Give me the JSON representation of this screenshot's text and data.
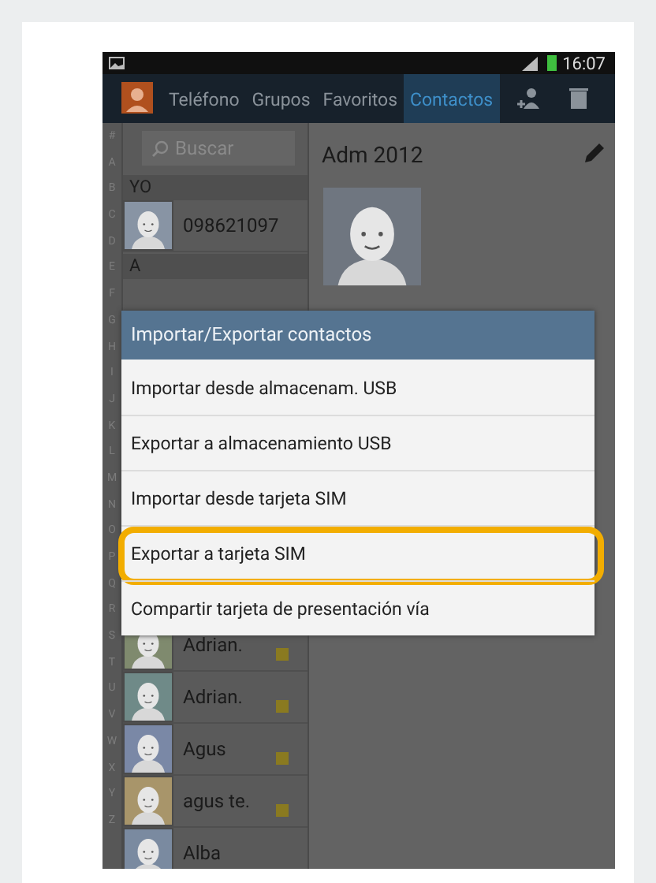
{
  "status_bar": {
    "time": "16:07"
  },
  "action_bar": {
    "tabs": [
      {
        "label": "Teléfono",
        "selected": false
      },
      {
        "label": "Grupos",
        "selected": false
      },
      {
        "label": "Favoritos",
        "selected": false
      },
      {
        "label": "Contactos",
        "selected": true
      }
    ]
  },
  "index": [
    "#",
    "A",
    "B",
    "C",
    "D",
    "E",
    "F",
    "G",
    "H",
    "I",
    "J",
    "K",
    "L",
    "M",
    "N",
    "O",
    "P",
    "Q",
    "R",
    "S",
    "T",
    "U",
    "V",
    "W",
    "X",
    "Y",
    "Z"
  ],
  "search": {
    "placeholder": "Buscar"
  },
  "contacts_top": [
    {
      "kind": "header",
      "label": "YO"
    },
    {
      "kind": "contact",
      "name": "098621097",
      "color": "#8894a4",
      "sim": false
    },
    {
      "kind": "header",
      "label": "A"
    }
  ],
  "contacts_bottom": [
    {
      "kind": "contact",
      "name": "Adrian.",
      "color": "#7f8a6e",
      "sim": true
    },
    {
      "kind": "contact",
      "name": "Adrian.",
      "color": "#6f8a88",
      "sim": true
    },
    {
      "kind": "contact",
      "name": "Agus",
      "color": "#7a88a6",
      "sim": true
    },
    {
      "kind": "contact",
      "name": "agus te.",
      "color": "#a8956a",
      "sim": true
    },
    {
      "kind": "contact",
      "name": "Alba",
      "color": "#7a8aa0",
      "sim": false
    }
  ],
  "detail": {
    "name": "Adm 2012"
  },
  "dialog": {
    "title": "Importar/Exportar contactos",
    "items": [
      {
        "label": "Importar desde almacenam. USB",
        "highlighted": false
      },
      {
        "label": "Exportar a almacenamiento USB",
        "highlighted": false
      },
      {
        "label": "Importar desde tarjeta SIM",
        "highlighted": false
      },
      {
        "label": "Exportar a tarjeta SIM",
        "highlighted": true
      },
      {
        "label": "Compartir tarjeta de presentación vía",
        "highlighted": false
      }
    ]
  }
}
